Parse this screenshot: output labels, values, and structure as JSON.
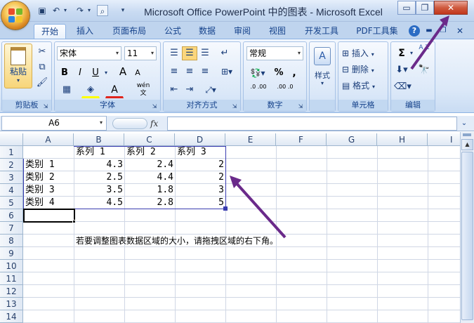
{
  "window": {
    "title": "Microsoft Office PowerPoint 中的图表 - Microsoft Excel",
    "controls": {
      "minimize": "▭",
      "restore": "❐",
      "close": "✕"
    }
  },
  "quick_access": [
    {
      "name": "save-icon",
      "glyph": "💾"
    },
    {
      "name": "undo-icon",
      "glyph": "↶"
    },
    {
      "name": "redo-icon",
      "glyph": "↷"
    },
    {
      "name": "print-preview-icon",
      "glyph": "🔍"
    }
  ],
  "tabs": [
    "开始",
    "插入",
    "页面布局",
    "公式",
    "数据",
    "审阅",
    "视图",
    "开发工具",
    "PDF工具集"
  ],
  "ribbon": {
    "clipboard": {
      "label": "剪贴板",
      "paste": "粘贴"
    },
    "font": {
      "label": "字体",
      "font_name": "宋体",
      "font_size": "11",
      "bold": "B",
      "italic": "I",
      "underline": "U",
      "grow": "A",
      "shrink": "A",
      "font_color": "A",
      "phonetic": "wén 文"
    },
    "alignment": {
      "label": "对齐方式"
    },
    "number": {
      "label": "数字",
      "format": "常规",
      "percent": "%",
      "comma": ",",
      "inc_decimal": ".0 .00",
      "dec_decimal": ".00 .0"
    },
    "styles": {
      "label": "",
      "button": "样式"
    },
    "cells": {
      "label": "单元格",
      "insert": "插入",
      "delete": "删除",
      "format": "格式"
    },
    "editing": {
      "label": "编辑",
      "sum": "Σ",
      "sort": "A Z"
    }
  },
  "formula_bar": {
    "name_box": "A6",
    "fx": "fx",
    "value": ""
  },
  "columns": [
    "A",
    "B",
    "C",
    "D",
    "E",
    "F",
    "G",
    "H",
    "I"
  ],
  "rows": [
    "1",
    "2",
    "3",
    "4",
    "5",
    "6",
    "7",
    "8",
    "9",
    "10",
    "11",
    "12",
    "13",
    "14"
  ],
  "sheet": {
    "r1": {
      "B": "系列 1",
      "C": "系列 2",
      "D": "系列 3"
    },
    "r2": {
      "A": "类别 1",
      "B": "4.3",
      "C": "2.4",
      "D": "2"
    },
    "r3": {
      "A": "类别 2",
      "B": "2.5",
      "C": "4.4",
      "D": "2"
    },
    "r4": {
      "A": "类别 3",
      "B": "3.5",
      "C": "1.8",
      "D": "3"
    },
    "r5": {
      "A": "类别 4",
      "B": "4.5",
      "C": "2.8",
      "D": "5"
    },
    "r8": {
      "B": "若要调整图表数据区域的大小，请拖拽区域的右下角。"
    }
  },
  "colors": {
    "accent": "#15428b",
    "arrow": "#6a2a8a",
    "selection": "#000000",
    "range_border": "#3a3cb0"
  }
}
